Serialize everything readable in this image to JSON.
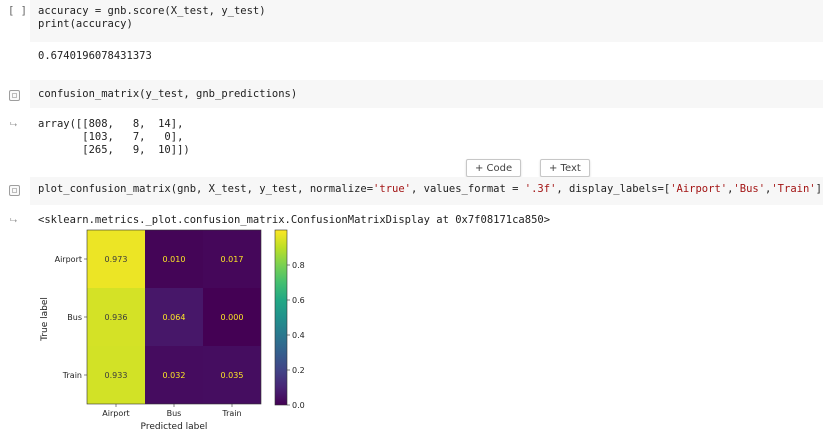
{
  "cells": [
    {
      "gutter": "[ ]",
      "code": [
        "accuracy = gnb.score(X_test, y_test)",
        "print(accuracy)"
      ],
      "output": [
        "0.6740196078431373"
      ]
    },
    {
      "code": [
        "confusion_matrix(y_test, gnb_predictions)"
      ],
      "output": [
        "array([[808,   8,  14],",
        "       [103,   7,   0],",
        "       [265,   9,  10]])"
      ]
    },
    {
      "code_prefix": "plot_confusion_matrix(gnb, X_test, y_test, normalize=",
      "code_s1": "'true'",
      "code_mid": ", values_format = ",
      "code_s2": "'.3f'",
      "code_mid2": ", display_labels=[",
      "code_s3": "'Airport'",
      "code_c1": ",",
      "code_s4": "'Bus'",
      "code_c2": ",",
      "code_s5": "'Train'",
      "code_end": "])",
      "output": [
        "<sklearn.metrics._plot.confusion_matrix.ConfusionMatrixDisplay at 0x7f08171ca850>"
      ]
    }
  ],
  "toolbar": {
    "add_code": "+ Code",
    "add_text": "+ Text"
  },
  "chart_data": {
    "type": "heatmap",
    "rows": [
      "Airport",
      "Bus",
      "Train"
    ],
    "cols": [
      "Airport",
      "Bus",
      "Train"
    ],
    "values": [
      [
        "0.973",
        "0.010",
        "0.017"
      ],
      [
        "0.936",
        "0.064",
        "0.000"
      ],
      [
        "0.933",
        "0.032",
        "0.035"
      ]
    ],
    "xlabel": "Predicted label",
    "ylabel": "True label",
    "colorbar_ticks": [
      "0.8",
      "0.6",
      "0.4",
      "0.2",
      "0.0"
    ],
    "colormap": "viridis",
    "range": [
      0,
      1
    ]
  }
}
